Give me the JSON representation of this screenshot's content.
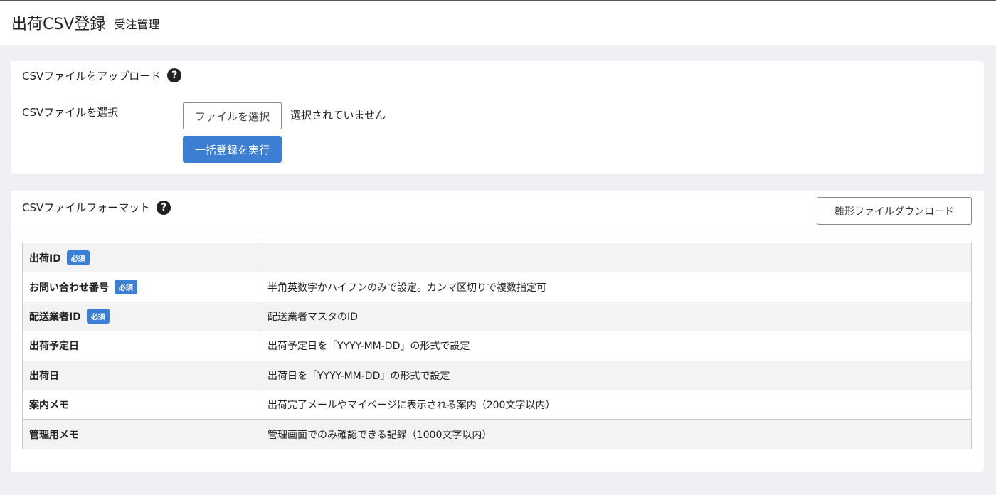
{
  "header": {
    "title": "出荷CSV登録",
    "subtitle": "受注管理"
  },
  "upload": {
    "title": "CSVファイルをアップロード",
    "help_icon": "question-circle-icon",
    "field_label": "CSVファイルを選択",
    "file_button_label": "ファイルを選択",
    "file_status": "選択されていません",
    "submit_label": "一括登録を実行"
  },
  "format": {
    "title": "CSVファイルフォーマット",
    "help_icon": "question-circle-icon",
    "download_label": "雛形ファイルダウンロード",
    "rows": [
      {
        "name": "出荷ID",
        "required": "必須",
        "desc": ""
      },
      {
        "name": "お問い合わせ番号",
        "required": "必須",
        "desc": "半角英数字かハイフンのみで設定。カンマ区切りで複数指定可"
      },
      {
        "name": "配送業者ID",
        "required": "必須",
        "desc": "配送業者マスタのID"
      },
      {
        "name": "出荷予定日",
        "required": "",
        "desc": "出荷予定日を「YYYY-MM-DD」の形式で設定"
      },
      {
        "name": "出荷日",
        "required": "",
        "desc": "出荷日を「YYYY-MM-DD」の形式で設定"
      },
      {
        "name": "案内メモ",
        "required": "",
        "desc": "出荷完了メールやマイページに表示される案内（200文字以内）"
      },
      {
        "name": "管理用メモ",
        "required": "",
        "desc": "管理画面でのみ確認できる記録（1000文字以内）"
      }
    ]
  },
  "colors": {
    "primary": "#3b7fd4",
    "background": "#eef0f4"
  }
}
